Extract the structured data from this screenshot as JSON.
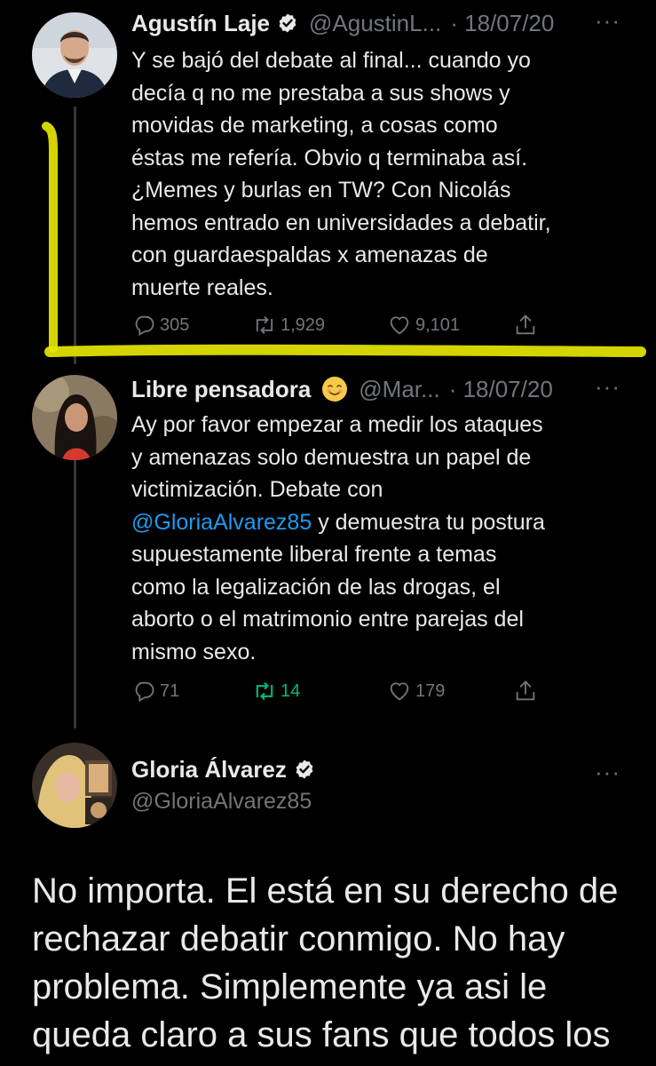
{
  "tweets": [
    {
      "name": "Agustín Laje",
      "handle": "@AgustinL...",
      "time": "· 18/07/20",
      "text": "Y se bajó del debate al final... cuando yo\ndecía q no me prestaba a sus shows y\nmovidas de marketing, a cosas como\néstas me refería. Obvio q terminaba así.\n¿Memes y burlas en TW? Con Nicolás\nhemos entrado en universidades a debatir,\ncon guardaespaldas x amenazas de\nmuerte reales.",
      "replies": "305",
      "retweets": "1,929",
      "likes": "9,101"
    },
    {
      "name": "Libre pensadora",
      "handle": "@Mar...",
      "time": "· 18/07/20",
      "text_before": "Ay por favor empezar a medir los ataques\ny amenazas solo demuestra un papel de\nvictimización. Debate con\n",
      "mention": "@GloriaAlvarez85",
      "text_after": " y demuestra tu postura\nsupuestamente liberal frente a temas\ncomo la legalización de las drogas, el\naborto o el matrimonio entre parejas del\nmismo sexo.",
      "replies": "71",
      "retweets": "14",
      "likes": "179"
    },
    {
      "name": "Gloria Álvarez",
      "handle": "@GloriaAlvarez85",
      "text": "No importa. El está en su derecho de\nrechazar debatir conmigo. No hay\nproblema. Simplemente ya asi le\nqueda claro a sus fans que todos los"
    }
  ],
  "ui": {
    "more_label": "···"
  },
  "colors": {
    "background": "#000000",
    "text": "#e7e9ea",
    "muted": "#71767b",
    "link": "#1d9bf0",
    "retweet_active": "#00ba7c",
    "verified": "#e7e9ea",
    "highlighter": "#e6e600"
  },
  "icons": [
    "reply-icon",
    "retweet-icon",
    "like-icon",
    "share-icon",
    "verified-badge-icon",
    "more-icon",
    "smiling-face-emoji"
  ]
}
